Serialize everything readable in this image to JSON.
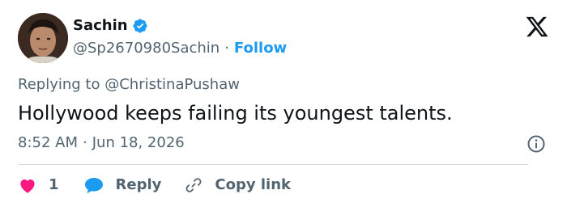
{
  "author": {
    "name": "Sachin",
    "handle": "@Sp2670980Sachin",
    "separator": "·",
    "follow_label": "Follow"
  },
  "reply_context": {
    "prefix": "Replying to",
    "mention": "@ChristinaPushaw"
  },
  "tweet": {
    "text": "Hollywood keeps failing its youngest talents.",
    "time": "8:52 AM",
    "separator": "·",
    "date": "Jun 18, 2026"
  },
  "actions": {
    "like_count": "1",
    "reply_label": "Reply",
    "copy_label": "Copy link"
  },
  "colors": {
    "accent": "#1d9bf0",
    "like": "#f91880",
    "secondary_text": "#536471",
    "primary_text": "#0f1419",
    "divider": "#cfd9de"
  },
  "icons": {
    "verified": "verified-badge-icon",
    "brand": "x-logo-icon",
    "info": "info-icon",
    "like": "heart-icon",
    "reply": "speech-bubble-icon",
    "copy": "link-icon"
  }
}
